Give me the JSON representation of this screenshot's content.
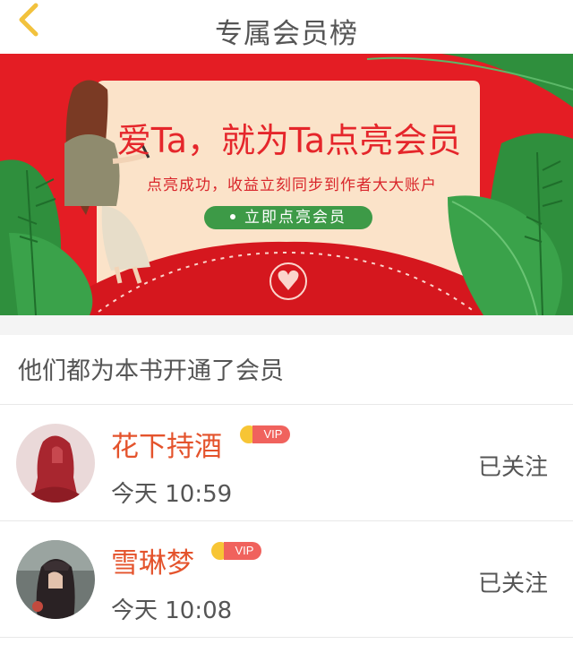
{
  "header": {
    "title": "专属会员榜",
    "back_icon": "chevron-left-icon",
    "back_color": "#f2c23d"
  },
  "banner": {
    "headline": "爱Ta，就为Ta点亮会员",
    "subtitle": "点亮成功，收益立刻同步到作者大大账户",
    "cta_label": "立即点亮会员",
    "background": "#e41d24",
    "cta_color": "#3d9a47"
  },
  "section": {
    "title": "他们都为本书开通了会员"
  },
  "members": [
    {
      "name": "花下持酒",
      "badge": "VIP",
      "time": "今天 10:59",
      "follow_label": "已关注"
    },
    {
      "name": "雪琳梦",
      "badge": "VIP",
      "time": "今天 10:08",
      "follow_label": "已关注"
    }
  ],
  "colors": {
    "name": "#e4532c",
    "vip_badge": "#f0625d",
    "crown": "#f7c535"
  }
}
